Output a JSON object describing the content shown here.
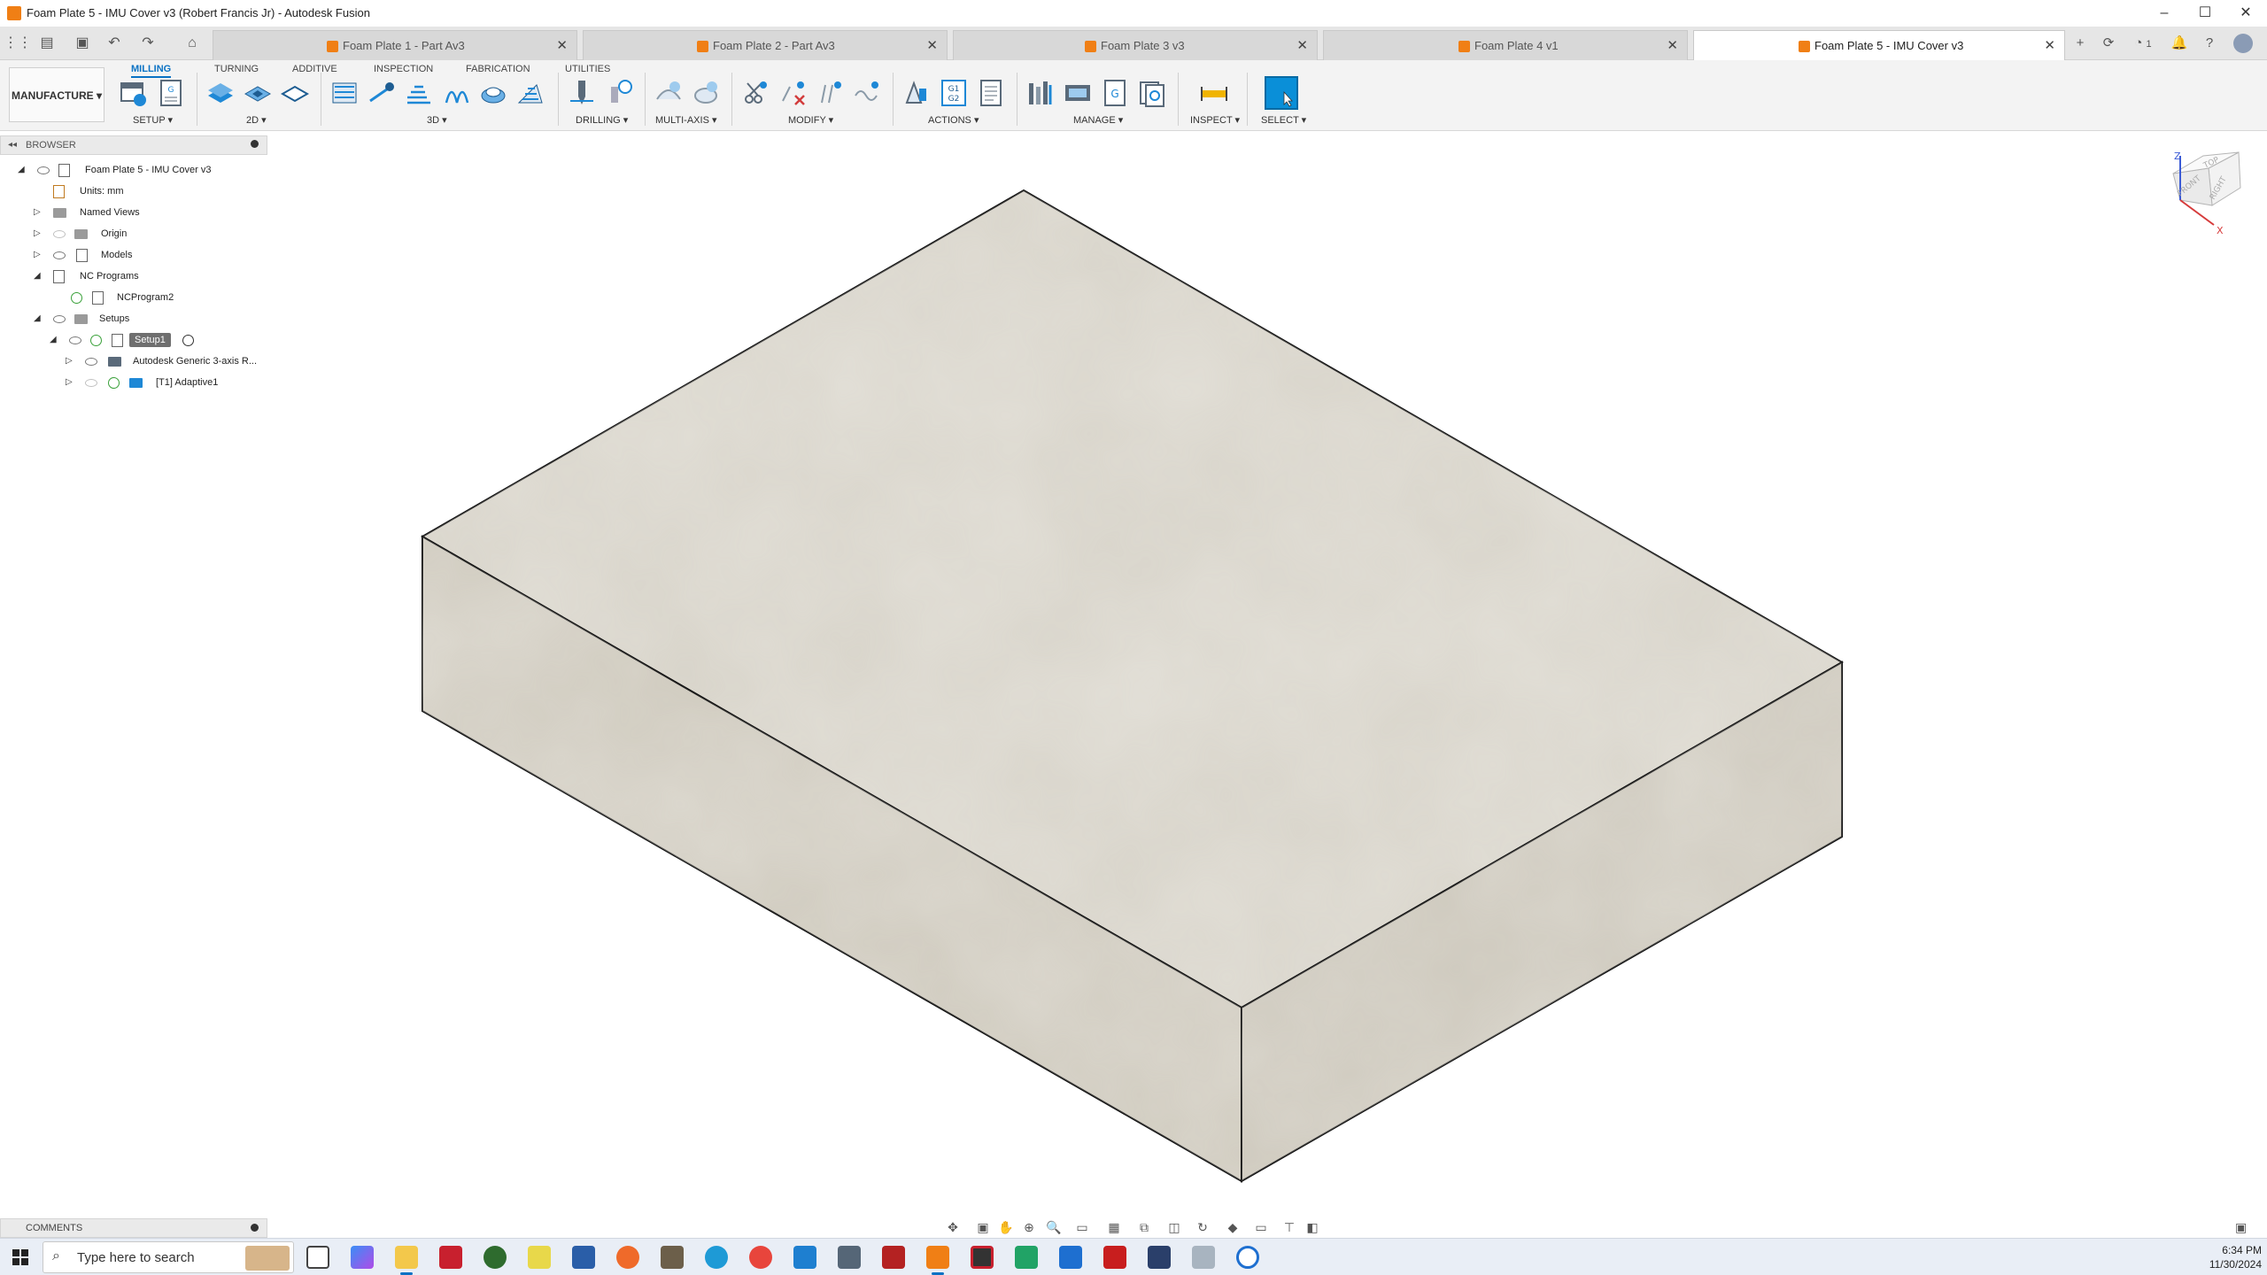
{
  "window": {
    "title": "Foam Plate 5 - IMU Cover v3 (Robert Francis Jr) - Autodesk Fusion",
    "controls": [
      "minimize",
      "maximize",
      "close"
    ]
  },
  "doc_tabs": [
    {
      "label": "Foam Plate 1 - Part Av3",
      "active": false
    },
    {
      "label": "Foam Plate 2 - Part Av3",
      "active": false
    },
    {
      "label": "Foam Plate 3 v3",
      "active": false
    },
    {
      "label": "Foam Plate 4 v1",
      "active": false
    },
    {
      "label": "Foam Plate 5 - IMU Cover v3",
      "active": true
    }
  ],
  "doc_tab_close": "✕",
  "notification_count": "1",
  "ribbon": {
    "workspace": "MANUFACTURE",
    "tabs": [
      "MILLING",
      "TURNING",
      "ADDITIVE",
      "INSPECTION",
      "FABRICATION",
      "UTILITIES"
    ],
    "active_tab": "MILLING",
    "groups": {
      "setup": "SETUP ▾",
      "twod": "2D ▾",
      "threed": "3D ▾",
      "drilling": "DRILLING ▾",
      "multiaxis": "MULTI-AXIS ▾",
      "modify": "MODIFY ▾",
      "actions": "ACTIONS ▾",
      "manage": "MANAGE ▾",
      "inspect": "INSPECT ▾",
      "select": "SELECT ▾"
    },
    "g_code_text": "G1\nG2"
  },
  "browser": {
    "header": "BROWSER",
    "root": "Foam Plate 5 - IMU Cover v3",
    "units": "Units: mm",
    "named_views": "Named Views",
    "origin": "Origin",
    "models": "Models",
    "nc_programs": "NC Programs",
    "ncprogram2": "NCProgram2",
    "setups": "Setups",
    "setup1": "Setup1",
    "machine": "Autodesk Generic 3-axis R...",
    "adaptive": "[T1] Adaptive1"
  },
  "viewcube": {
    "top": "TOP",
    "front": "FRONT",
    "right": "RIGHT",
    "axis_z": "Z",
    "axis_x": "X"
  },
  "comments": {
    "label": "COMMENTS"
  },
  "taskbar": {
    "search_placeholder": "Type here to search",
    "time": "6:34 PM",
    "date": "11/30/2024"
  },
  "colors": {
    "accent": "#0a72c4",
    "fusion_orange": "#f07f15",
    "stock_face": "#d6d2c8"
  }
}
